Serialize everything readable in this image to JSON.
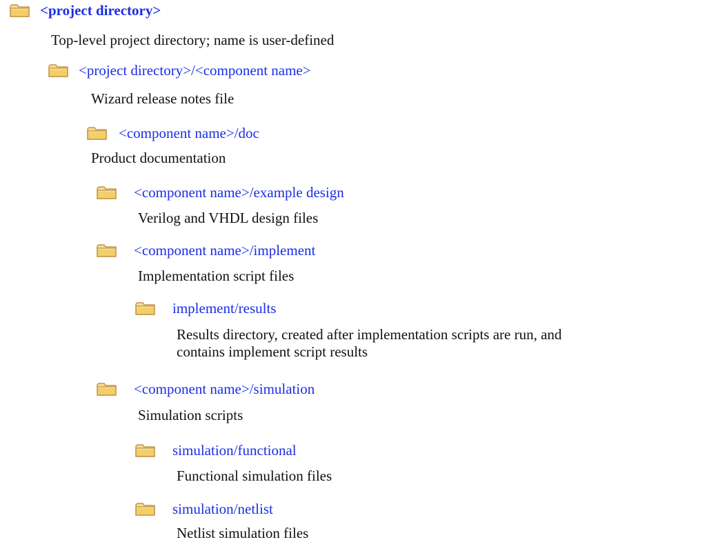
{
  "tree": {
    "root": {
      "label": "<project directory>",
      "description": "Top-level project directory; name is user-defined"
    },
    "component": {
      "label": "<project directory>/<component name>",
      "description": "Wizard release notes file"
    },
    "doc": {
      "label": "<component name>/doc",
      "description": "Product documentation"
    },
    "example_design": {
      "label": "<component name>/example design",
      "description": "Verilog and VHDL design files"
    },
    "implement": {
      "label": "<component name>/implement",
      "description": "Implementation script files"
    },
    "implement_results": {
      "label": "implement/results",
      "description_line1": "Results directory, created after implementation scripts are run, and",
      "description_line2": "contains implement script results"
    },
    "simulation": {
      "label": "<component name>/simulation",
      "description": "Simulation scripts"
    },
    "simulation_functional": {
      "label": "simulation/functional",
      "description": "Functional simulation files"
    },
    "simulation_netlist": {
      "label": "simulation/netlist",
      "description": "Netlist simulation files"
    }
  },
  "icons": {
    "folder": "folder-icon"
  },
  "colors": {
    "link": "#1a2ee6",
    "text": "#111111",
    "folder_body": "#f2d27a",
    "folder_edge": "#b8862e"
  }
}
